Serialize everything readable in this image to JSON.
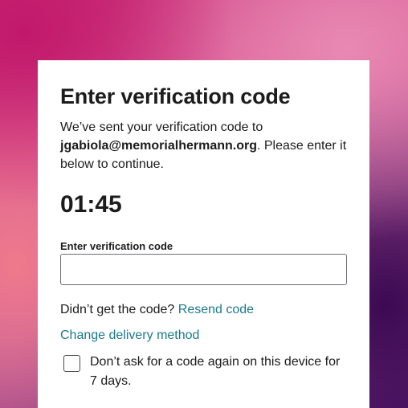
{
  "dialog": {
    "title": "Enter verification code",
    "desc_prefix": "We’ve sent your verification code to ",
    "email": "jgabiola@memorialhermann.org",
    "desc_suffix": ". Please enter it below to continue.",
    "timer": "01:45",
    "field_label": "Enter verification code",
    "field_value": "",
    "resend_prompt": "Didn’t get the code?",
    "resend_link": "Resend code",
    "change_link": "Change delivery method",
    "remember_label": "Don’t ask for a code again on this device for 7 days.",
    "remember_checked": false
  },
  "colors": {
    "link": "#1a7a8c",
    "text": "#1d1c1d"
  }
}
